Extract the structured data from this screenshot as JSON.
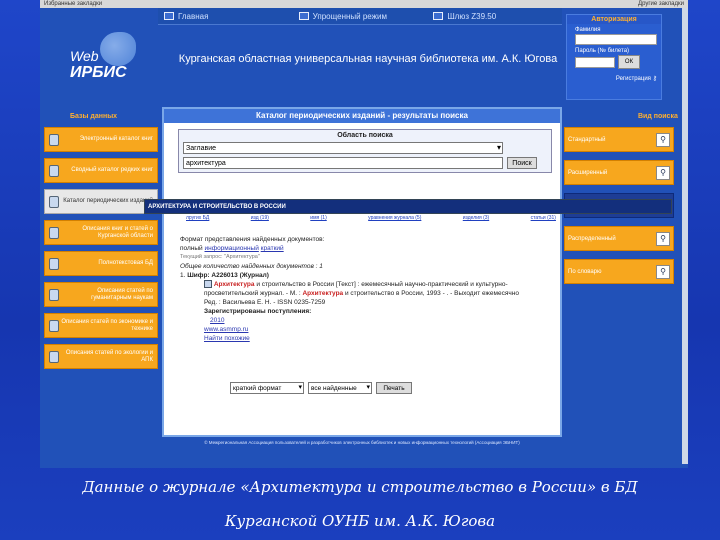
{
  "browser": {
    "left_text": "Избранные закладки",
    "right_text": "Другие закладки"
  },
  "topnav": [
    {
      "label": "Главная"
    },
    {
      "label": "Упрощенный режим"
    },
    {
      "label": "Шлюз Z39.50"
    }
  ],
  "logo": {
    "web": "Web",
    "irbis": "ИРБИС"
  },
  "header": {
    "title": "Курганская областная универсальная научная библиотека им. А.К. Югова"
  },
  "auth": {
    "title": "Авторизация",
    "surname_label": "Фамилия",
    "password_label": "Пароль (№ билета)",
    "ok_label": "ОК",
    "register": "Регистрация"
  },
  "left_panel": {
    "title": "Базы данных",
    "items": [
      "Электронный каталог книг",
      "Сводный каталог редких книг",
      "Каталог периодических изданий",
      "Описания книг и статей о Курганской области",
      "Полнотекстовая БД",
      "Описания статей по гуманитарным наукам",
      "Описания статей по экономике и технике",
      "Описания статей по экологии и АПК"
    ]
  },
  "right_panel": {
    "title": "Вид поиска",
    "items": [
      "Стандартный",
      "Расширенный",
      "",
      "Распределенный",
      "По словарю"
    ]
  },
  "main": {
    "title": "Каталог периодических изданий - результаты поиска",
    "area_title": "Область поиска",
    "select_value": "Заглавие",
    "input_value": "архитектура",
    "search_button": "Поиск",
    "highlight": "АРХИТЕКТУРА И СТРОИТЕЛЬСТВО В РОССИИ",
    "tabs": [
      "лругих БД",
      "изд (19)",
      "имя (1)",
      "уравнения журнала (5)",
      "изделия (3)",
      "статьи (31)"
    ],
    "format_line": "Формат представления найденных документов:",
    "format_full": "полный",
    "format_info": "информационный",
    "format_short": "краткий",
    "gray_line": "Текущий запрос: \"Архитектура\"",
    "total_label": "Общее количество найденных документов : 1",
    "record_num": "1.",
    "shelf": "Шифр: А226013 (Журнал)",
    "rec_title_red": "Архитектура",
    "rec_title_rest": "и строительство в России [Текст] : ежемесячный научно-практический и культурно-просветительский журнал. - М. :",
    "rec_red2": "Архитектура",
    "rec_rest2": "и строительство в России, 1993 - . - Выходит ежемесячно",
    "editor": "Ред. : Васильева Е. Н. - ISSN 0235-7259",
    "registered": "Зарегистрированы поступления:",
    "year": "2010",
    "site": "www.asmmp.ru",
    "similar": "Найти похожие",
    "format_select": "краткий формат",
    "scope_select": "все найденные",
    "print_button": "Печать"
  },
  "footer": "© Межрегиональная Ассоциация пользователей и разработчиков электронных библиотек и новых информационных технологий (Ассоциация ЭБНИТ)",
  "caption": {
    "line1": "Данные о журнале «Архитектура и строительство в России» в БД",
    "line2": "Курганской ОУНБ им. А.К. Югова"
  }
}
